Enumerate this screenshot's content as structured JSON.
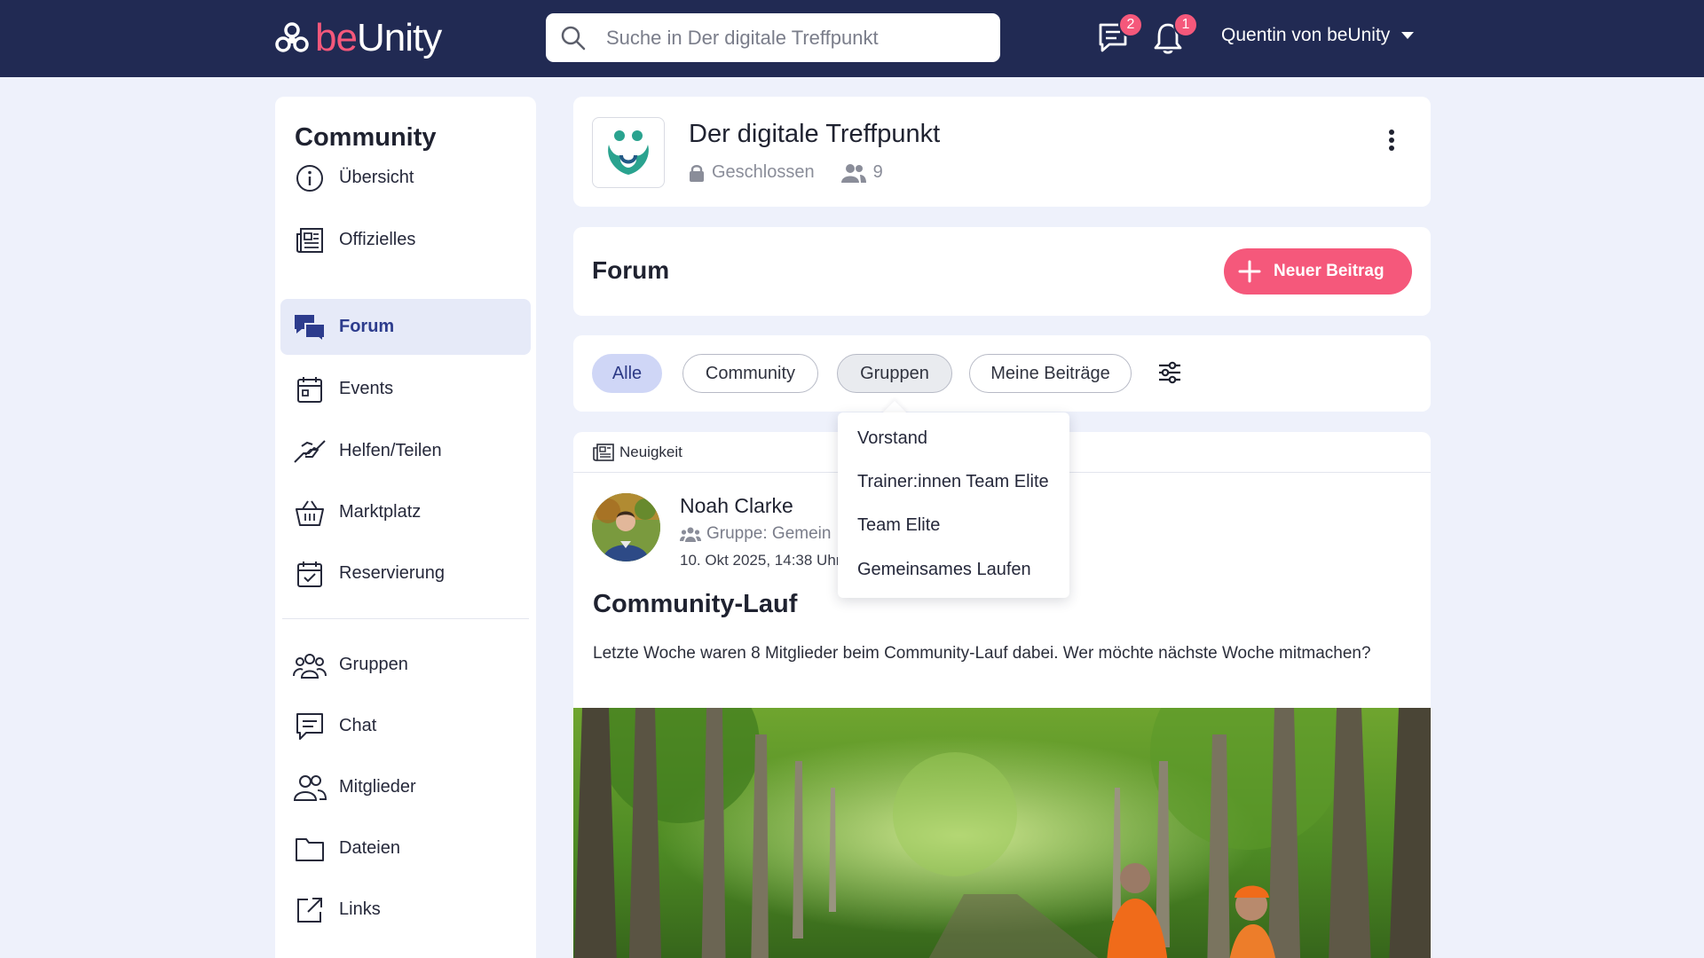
{
  "header": {
    "logo_be": "be",
    "logo_unity": "Unity",
    "search_placeholder": "Suche in Der digitale Treffpunkt",
    "chat_badge": "2",
    "notification_badge": "1",
    "user_name": "Quentin von beUnity"
  },
  "sidebar": {
    "title": "Community",
    "items": [
      {
        "label": "Übersicht",
        "icon": "info-icon"
      },
      {
        "label": "Offizielles",
        "icon": "newspaper-icon"
      },
      {
        "label": "Forum",
        "icon": "forum-icon",
        "active": true
      },
      {
        "label": "Events",
        "icon": "calendar-icon"
      },
      {
        "label": "Helfen/Teilen",
        "icon": "helping-hands-icon"
      },
      {
        "label": "Marktplatz",
        "icon": "basket-icon"
      },
      {
        "label": "Reservierung",
        "icon": "calendar-check-icon"
      },
      {
        "label": "Gruppen",
        "icon": "groups-icon"
      },
      {
        "label": "Chat",
        "icon": "chat-icon"
      },
      {
        "label": "Mitglieder",
        "icon": "members-icon"
      },
      {
        "label": "Dateien",
        "icon": "folder-icon"
      },
      {
        "label": "Links",
        "icon": "external-link-icon"
      }
    ]
  },
  "group": {
    "name": "Der digitale Treffpunkt",
    "privacy": "Geschlossen",
    "member_count": "9"
  },
  "forum": {
    "title": "Forum",
    "new_post_label": "Neuer Beitrag"
  },
  "filters": {
    "chips": [
      "Alle",
      "Community",
      "Gruppen",
      "Meine Beiträge"
    ],
    "selected": "Alle",
    "open": "Gruppen"
  },
  "dropdown": {
    "items": [
      "Vorstand",
      "Trainer:innen Team Elite",
      "Team Elite",
      "Gemeinsames Laufen"
    ]
  },
  "post": {
    "tag": "Neuigkeit",
    "author": "Noah Clarke",
    "group": "Gruppe: Gemein",
    "date": "10. Okt 2025, 14:38 Uhr",
    "title": "Community-Lauf",
    "body": "Letzte Woche waren 8 Mitglieder beim Community-Lauf dabei. Wer möchte nächste Woche mitmachen?"
  },
  "colors": {
    "topbar": "#212a53",
    "accent": "#f5587b",
    "active_nav": "#2d3c8d"
  }
}
